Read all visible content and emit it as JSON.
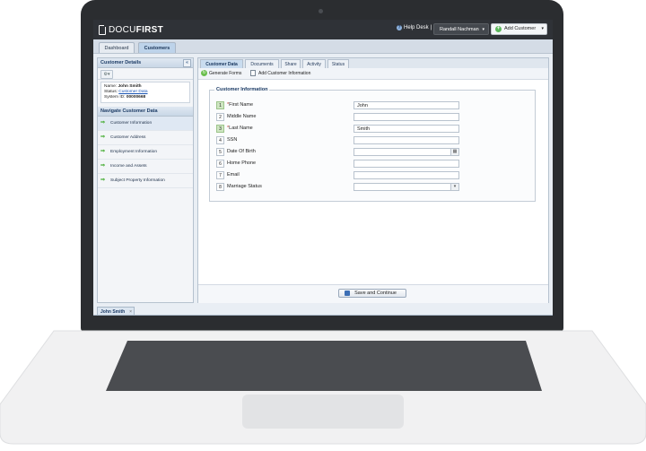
{
  "app": {
    "logo_light": "DOCU",
    "logo_bold": "FIRST",
    "help_desk": "Help Desk",
    "help_sep": "|",
    "user_name": "Randall Nachman",
    "add_customer": "Add Customer"
  },
  "nav_tabs": [
    "Dashboard",
    "Customers"
  ],
  "left": {
    "customer_details_title": "Customer Details",
    "name_label": "Name:",
    "name_value": "John Smith",
    "status_label": "Status:",
    "status_value": "Customer Data",
    "system_id_label": "System ID:",
    "system_id_value": "00000668",
    "navigate_title": "Navigate Customer Data",
    "nav_items": [
      "Customer Information",
      "Customer Address",
      "Employment Information",
      "Income and Assets",
      "Subject Property Information"
    ]
  },
  "content_tabs": [
    "Customer Data",
    "Documents",
    "Share",
    "Activity",
    "Status"
  ],
  "actions": {
    "generate_forms": "Generate Forms",
    "add_customer_info": "Add Customer Information"
  },
  "form": {
    "legend": "Customer Information",
    "rows": [
      {
        "num": "1",
        "label": "First Name",
        "required": true,
        "value": ""
      },
      {
        "num": "2",
        "label": "Middle Name",
        "required": false,
        "value": ""
      },
      {
        "num": "3",
        "label": "Last Name",
        "required": true,
        "value": ""
      },
      {
        "num": "4",
        "label": "SSN",
        "required": false,
        "value": ""
      },
      {
        "num": "5",
        "label": "Date Of Birth",
        "required": false,
        "value": ""
      },
      {
        "num": "6",
        "label": "Home Phone",
        "required": false,
        "value": ""
      },
      {
        "num": "7",
        "label": "Email",
        "required": false,
        "value": ""
      },
      {
        "num": "8",
        "label": "Marriage Status",
        "required": false,
        "value": ""
      }
    ],
    "values": {
      "first_name": "John",
      "last_name": "Smith"
    }
  },
  "save_button": "Save and Continue",
  "bottom_tab": "John Smith",
  "colors": {
    "accent_green": "#4caf3a",
    "topbar": "#2f3237",
    "required_badge": "#cfe6c2"
  }
}
